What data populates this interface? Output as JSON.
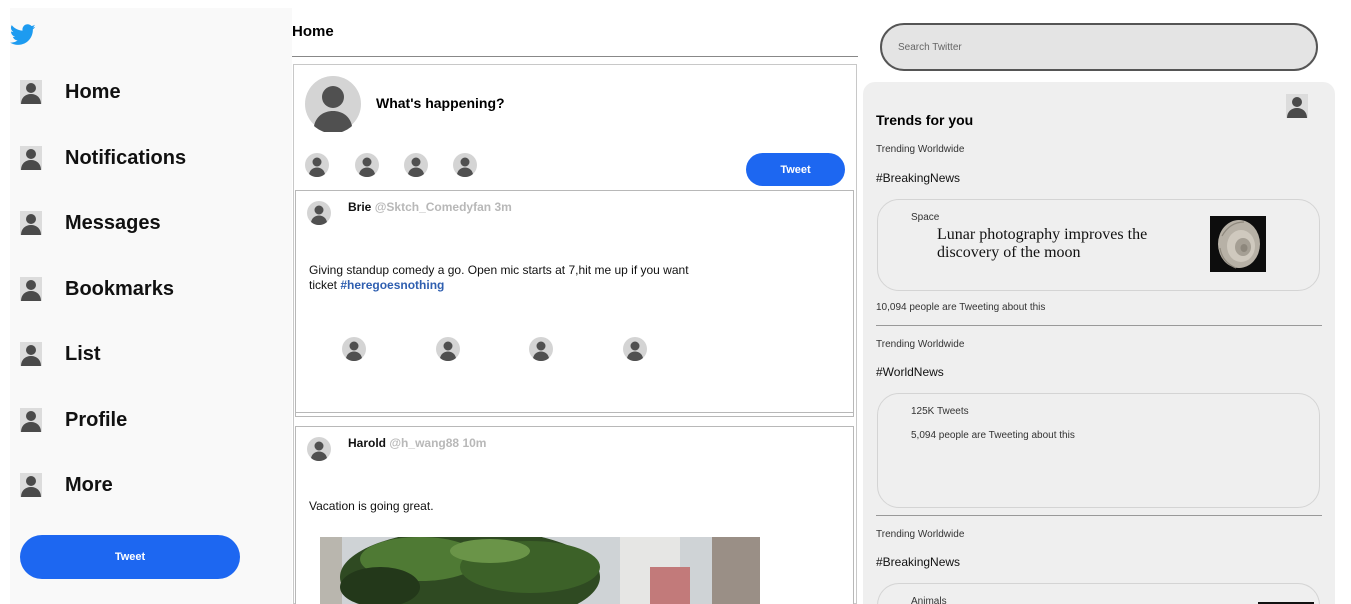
{
  "sidebar": {
    "items": [
      {
        "label": "Home"
      },
      {
        "label": "Notifications"
      },
      {
        "label": "Messages"
      },
      {
        "label": "Bookmarks"
      },
      {
        "label": "List"
      },
      {
        "label": "Profile"
      },
      {
        "label": "More"
      }
    ],
    "tweet_button": "Tweet"
  },
  "header": {
    "title": "Home"
  },
  "composer": {
    "prompt": "What's happening?",
    "tweet_button": "Tweet"
  },
  "feed": [
    {
      "name": "Brie",
      "handle": "@Sktch_Comedyfan",
      "time": "3m",
      "text": "Giving standup comedy a go. Open mic starts at 7,hit me up if you want ticket",
      "hashtag": "#heregoesnothing"
    },
    {
      "name": "Harold",
      "handle": "@h_wang88",
      "time": "10m",
      "text": "Vacation is going great."
    }
  ],
  "search": {
    "placeholder": "Search Twitter"
  },
  "trends": {
    "title": "Trends for you",
    "items": [
      {
        "context": "Trending Worldwide",
        "hashtag": "#BreakingNews",
        "card_category": "Space",
        "card_headline": "Lunar photography improves the discovery of the moon",
        "footer": "10,094 people are Tweeting about this"
      },
      {
        "context": "Trending Worldwide",
        "hashtag": "#WorldNews",
        "card_count": "125K Tweets",
        "card_detail": "5,094 people are Tweeting about this"
      },
      {
        "context": "Trending Worldwide",
        "hashtag": "#BreakingNews",
        "card_category": "Animals"
      }
    ]
  },
  "colors": {
    "brand_blue": "#1d9bf0",
    "button_blue": "#1d67f1",
    "hashtag_blue": "#2f5fb0",
    "meta_gray": "#b8b8b8",
    "panel_gray": "#efefef"
  },
  "icons": [
    "twitter-bird-icon",
    "user-icon",
    "avatar-placeholder-icon",
    "ammonite-fossil-thumbnail"
  ]
}
